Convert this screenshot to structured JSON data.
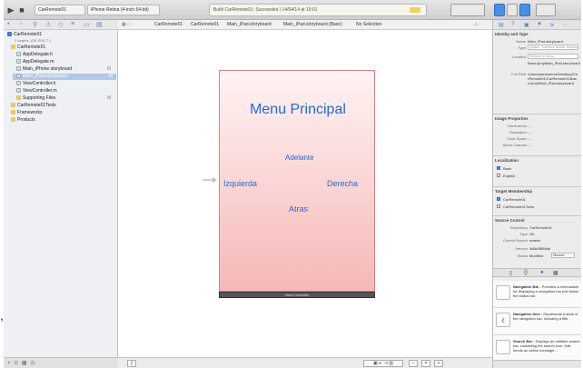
{
  "toolbar": {
    "scheme": "CarRemote01",
    "device": "iPhone Retina (4-inch 64-bit)",
    "activity": "Build CarRemote01: Succeeded | 14/04/14 at 19:01"
  },
  "navigator": {
    "items": [
      {
        "label": "CarRemote01",
        "sub": "2 targets, iOS SDK 7.1"
      },
      {
        "label": "CarRemote01"
      },
      {
        "label": "AppDelegate.h"
      },
      {
        "label": "AppDelegate.m"
      },
      {
        "label": "Main_iPhone.storyboard",
        "badge": "M"
      },
      {
        "label": "Main_iPad.storyboard",
        "badge": "M"
      },
      {
        "label": "ViewController.h"
      },
      {
        "label": "ViewController.m"
      },
      {
        "label": "Supporting Files",
        "badge": "M"
      },
      {
        "label": "CarRemote01Tests"
      },
      {
        "label": "Frameworks"
      },
      {
        "label": "Products"
      }
    ]
  },
  "jumpbar": {
    "crumbs": [
      "CarRemote01",
      "CarRemote01",
      "Main_iPad.storyboard",
      "Main_iPad.storyboard (Base)",
      "No Selection"
    ]
  },
  "scene": {
    "title": "Menu Principal",
    "adelante": "Adelante",
    "izquierda": "Izquierda",
    "derecha": "Derecha",
    "atras": "Atras",
    "footer": "View Controller"
  },
  "inspector": {
    "identity_header": "Identity and Type",
    "name_key": "Name",
    "name_val": "Main_iPad.storyboard",
    "type_key": "Type",
    "type_val": "Default - Interface Builder Storyboard",
    "location_key": "Location",
    "location_val": "Relative to Group",
    "location_detail": "Base.lproj/Main_iPad.storyboard",
    "fullpath_key": "Full Path",
    "fullpath_val": "/Users/parametros/Desktop/CarRemote01/CarRemote01/Base.lproj/Main_iPad.storyboard",
    "image_header": "Image Properties",
    "dimensions": "Dimensions ---",
    "resolution": "Resolution ---",
    "colorspace": "Color Space ---",
    "alpha": "Alpha Channel ---",
    "localization_header": "Localization",
    "loc_base": "Base",
    "loc_english": "English",
    "target_header": "Target Membership",
    "target_1": "CarRemote01",
    "target_2": "CarRemote01Tests",
    "source_header": "Source Control",
    "repo_key": "Repository",
    "repo_val": "CarRemote01",
    "sc_type_key": "Type",
    "sc_type_val": "Git",
    "branch_key": "Current Branch",
    "branch_val": "master",
    "version_key": "Version",
    "version_val": "4d8cf3866ab",
    "status_key": "Status",
    "status_val": "Modified",
    "discard": "Discard..."
  },
  "library": [
    {
      "title": "Navigation Bar",
      "desc": " - Provides a mechanism for displaying a navigation bar just below the status bar."
    },
    {
      "title": "Navigation Item",
      "desc": " - Represents a state of the navigation bar, including a title."
    },
    {
      "title": "Search Bar",
      "desc": " - Displays an editable search bar, containing the search icon, that sends an action message..."
    }
  ],
  "page_edge_text": ","
}
